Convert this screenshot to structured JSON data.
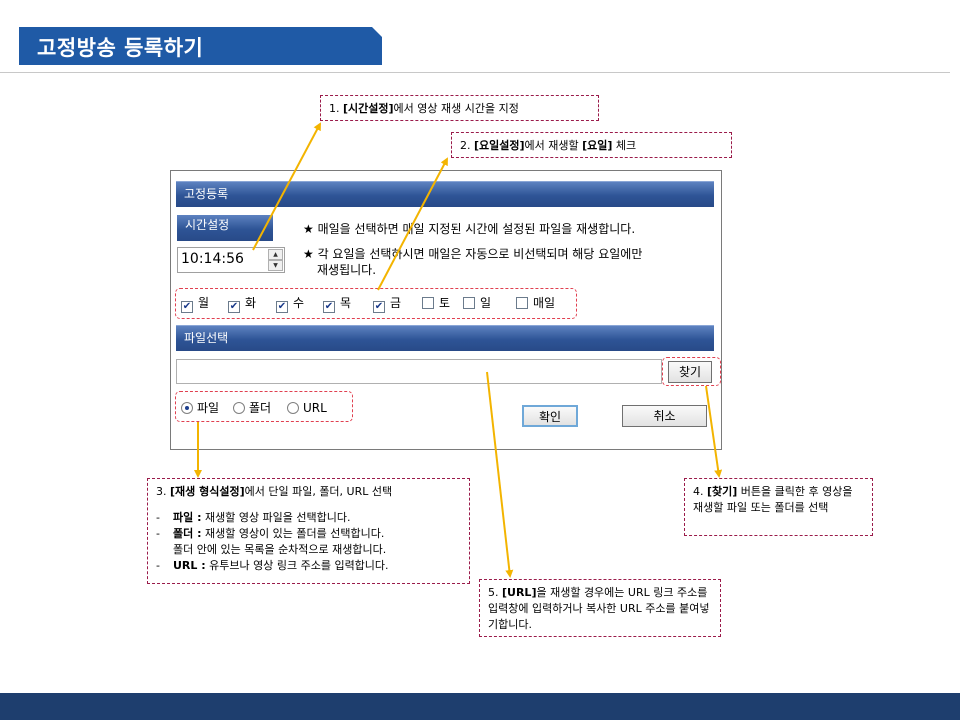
{
  "page": {
    "title": "고정방송 등록하기"
  },
  "callouts": {
    "c1": {
      "num": "1.",
      "bold": "[시간설정]",
      "rest": "에서 영상 재생 시간을 지정"
    },
    "c2": {
      "num": "2.",
      "bold": "[요일설정]",
      "rest": "에서 재생할 ",
      "bold2": "[요일]",
      "rest2": " 체크"
    },
    "c3": {
      "num": "3.",
      "bold": "[재생 형식설정]",
      "rest": "에서 단일 파일, 폴더, URL 선택",
      "items": [
        {
          "dash": "-",
          "bold": "파일 :",
          "text": " 재생할 영상 파일을 선택합니다."
        },
        {
          "dash": "-",
          "bold": "폴더 :",
          "text": " 재생할 영상이 있는 폴더를 선택합니다."
        },
        {
          "dash": "",
          "bold": "",
          "text": "폴더 안에 있는 목록을 순차적으로 재생합니다."
        },
        {
          "dash": "-",
          "bold": "URL :",
          "text": " 유투브나 영상 링크 주소를 입력합니다."
        }
      ]
    },
    "c4": {
      "num": "4.",
      "bold": "[찾기]",
      "rest": " 버튼을 클릭한 후 영상을 재생할 파일 또는 폴더를 선택"
    },
    "c5": {
      "num": "5.",
      "bold": "[URL]",
      "rest": "을 재생할 경우에는 URL 링크 주소를 입력창에 입력하거나 복사한 URL 주소를 붙여넣기합니다."
    }
  },
  "dialog": {
    "header": "고정등록",
    "time_tab": "시간설정",
    "time_value": "10:14:56",
    "note1": "★ 매일을 선택하면 매일 지정된 시간에 설정된 파일을 재생합니다.",
    "note2a": "★ 각 요일을 선택하시면 매일은 자동으로 비선택되며  해당 요일에만",
    "note2b": "재생됩니다.",
    "days": [
      {
        "label": "월",
        "checked": true
      },
      {
        "label": "화",
        "checked": true
      },
      {
        "label": "수",
        "checked": true
      },
      {
        "label": "목",
        "checked": true
      },
      {
        "label": "금",
        "checked": true
      },
      {
        "label": "토",
        "checked": false
      },
      {
        "label": "일",
        "checked": false
      },
      {
        "label": "매일",
        "checked": false
      }
    ],
    "file_header": "파일선택",
    "file_value": "",
    "browse_label": "찾기",
    "radios": [
      {
        "label": "파일",
        "selected": true
      },
      {
        "label": "폴더",
        "selected": false
      },
      {
        "label": "URL",
        "selected": false
      }
    ],
    "ok_label": "확인",
    "cancel_label": "취소"
  },
  "colors": {
    "title_tab": "#1f5aa6",
    "footer": "#1e3e6e",
    "section_bar": "#2e5496",
    "callout_border": "#9a1b4a",
    "arrow": "#f3b400",
    "highlight": "#e04050"
  }
}
